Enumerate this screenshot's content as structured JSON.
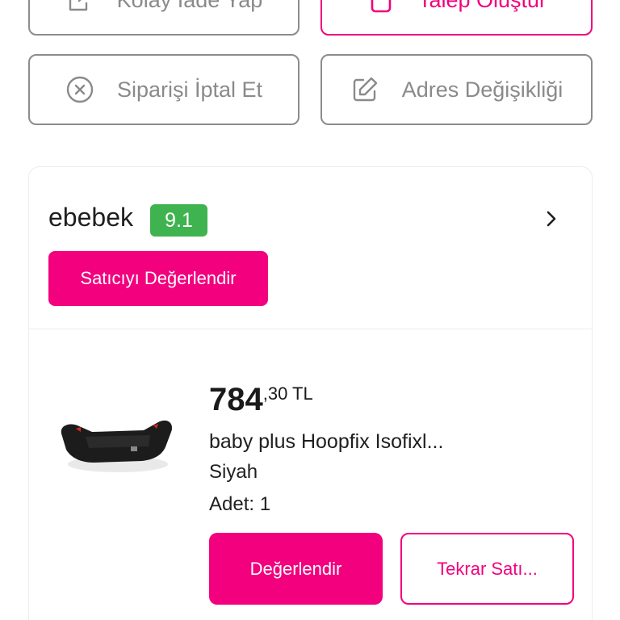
{
  "actions": {
    "easy_return_label": "Kolay İade Yap",
    "create_request_label": "Talep Oluştur",
    "cancel_order_label": "Siparişi İptal Et",
    "address_change_label": "Adres Değişikliği"
  },
  "seller": {
    "name": "ebebek",
    "score": "9.1",
    "rate_seller_label": "Satıcıyı Değerlendir"
  },
  "product": {
    "price_int": "784",
    "price_dec": ",30 TL",
    "title": "baby plus Hoopfix Isofixl...",
    "variant": "Siyah",
    "quantity": "Adet: 1",
    "rate_label": "Değerlendir",
    "rebuy_label": "Tekrar Satı..."
  },
  "colors": {
    "brand_pink": "#f2007e",
    "score_green": "#3fb34f",
    "muted_grey": "#8a8a8a"
  },
  "icons": [
    "return-icon",
    "request-icon",
    "cancel-circle-icon",
    "edit-address-icon",
    "chevron-right-icon"
  ]
}
